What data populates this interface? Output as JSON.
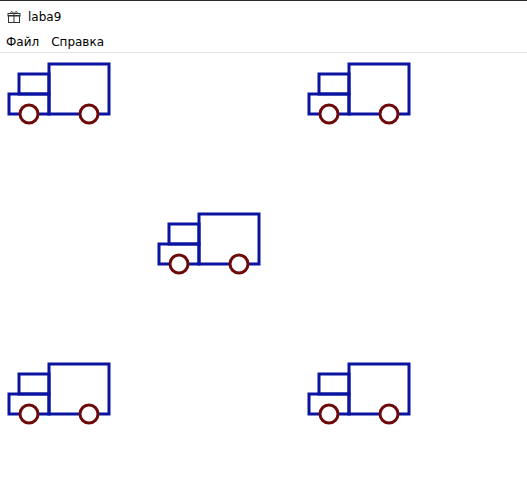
{
  "window": {
    "title": "laba9"
  },
  "menu": [
    {
      "label": "Файл"
    },
    {
      "label": "Справка"
    }
  ],
  "canvas": {
    "trucks": [
      {
        "kind": "truck"
      },
      {
        "kind": "truck"
      },
      {
        "kind": "truck"
      },
      {
        "kind": "truck"
      },
      {
        "kind": "truck"
      }
    ]
  }
}
